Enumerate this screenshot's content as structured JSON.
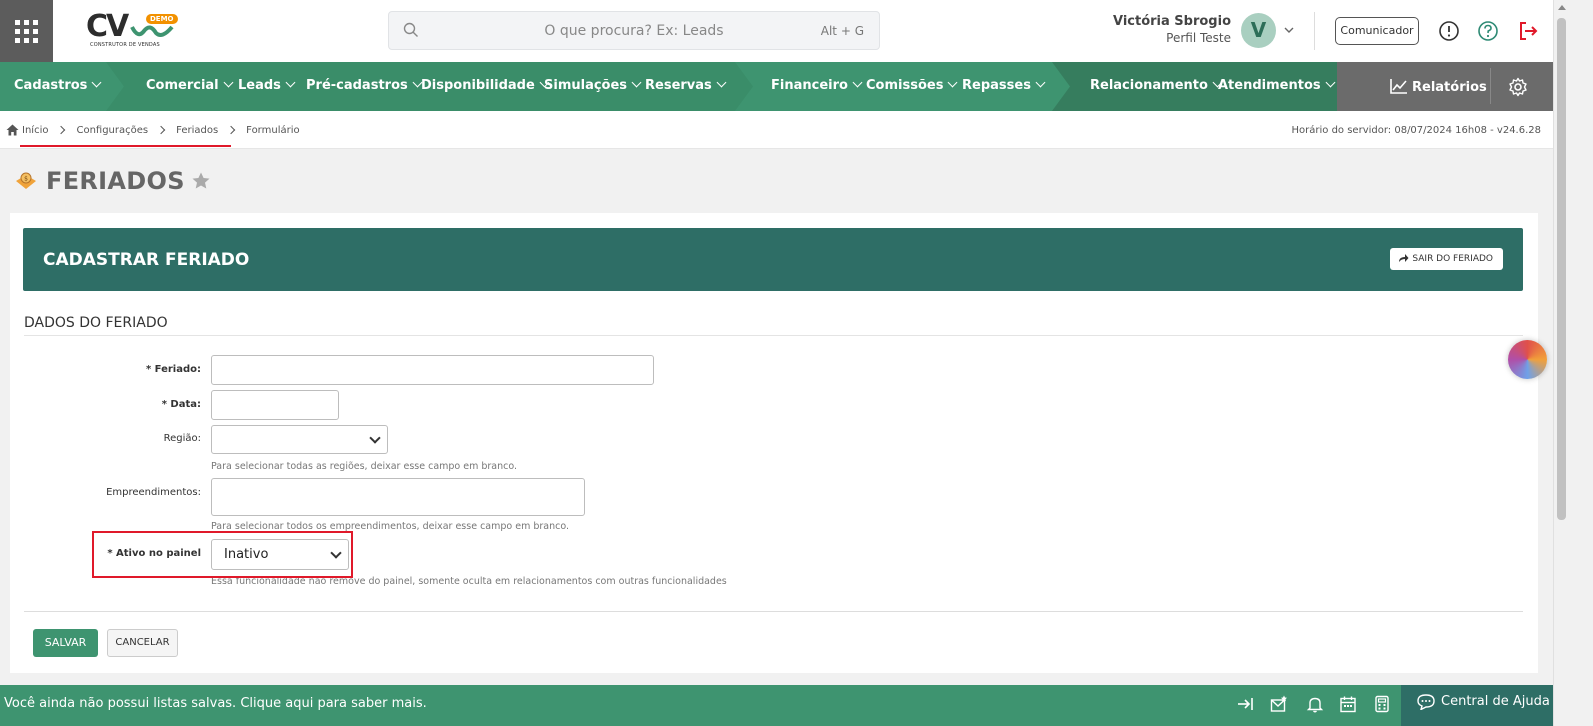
{
  "header": {
    "logo_text": "CV",
    "logo_badge": "DEMO",
    "logo_subtitle": "CONSTRUTOR DE VENDAS",
    "search_placeholder": "O que procura? Ex: Leads",
    "search_shortcut": "Alt + G",
    "user_name": "Victória Sbrogio",
    "user_profile": "Perfil Teste",
    "avatar_initial": "V",
    "communicator_label": "Comunicador"
  },
  "nav": {
    "items": [
      "Cadastros",
      "Comercial",
      "Leads",
      "Pré-cadastros",
      "Disponibilidade",
      "Simulações",
      "Reservas",
      "Financeiro",
      "Comissões",
      "Repasses",
      "Relacionamento",
      "Atendimentos"
    ],
    "reports_label": "Relatórios"
  },
  "breadcrumb": {
    "items": [
      "Início",
      "Configurações",
      "Feriados",
      "Formulário"
    ],
    "server_time": "Horário do servidor: 08/07/2024 16h08 - v24.6.28"
  },
  "page": {
    "title": "FERIADOS"
  },
  "form": {
    "card_title": "CADASTRAR FERIADO",
    "exit_label": "SAIR DO FERIADO",
    "section_title": "DADOS DO FERIADO",
    "fields": {
      "feriado_label": "* Feriado:",
      "feriado_value": "",
      "data_label": "* Data:",
      "data_value": "",
      "regiao_label": "Região:",
      "regiao_value": "",
      "regiao_help": "Para selecionar todas as regiões, deixar esse campo em branco.",
      "empreendimentos_label": "Empreendimentos:",
      "empreendimentos_help": "Para selecionar todos os empreendimentos, deixar esse campo em branco.",
      "ativo_label": "* Ativo no painel",
      "ativo_value": "Inativo",
      "ativo_help": "Essa funcionalidade não remove do painel, somente oculta em relacionamentos com outras funcionalidades"
    },
    "save_label": "SALVAR",
    "cancel_label": "CANCELAR"
  },
  "footer": {
    "message": "Você ainda não possui listas salvas. Clique aqui para saber mais.",
    "help_center": "Central de Ajuda"
  },
  "colors": {
    "primary": "#3e9470",
    "header_dark": "#2e6e66",
    "highlight": "#e0192a"
  }
}
